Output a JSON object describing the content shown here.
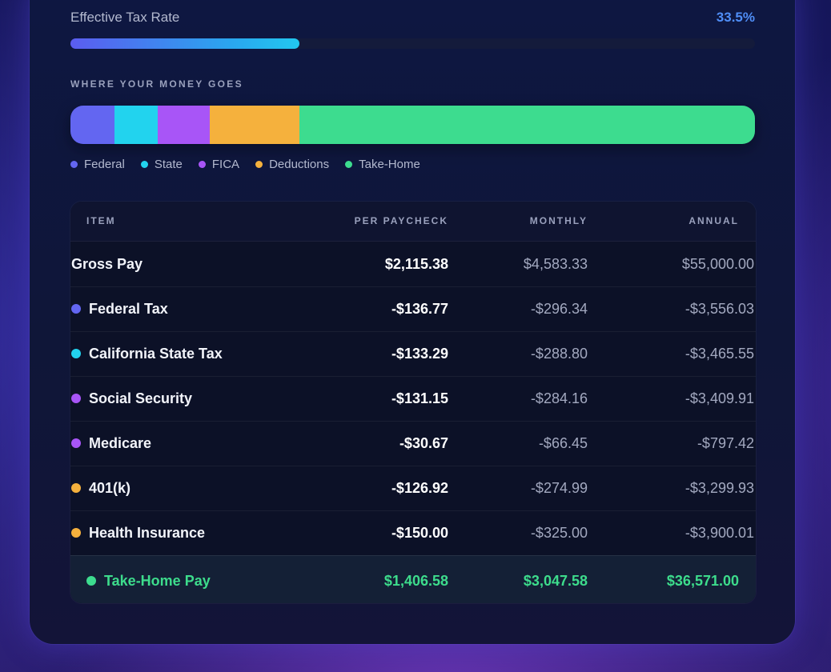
{
  "effective_tax": {
    "label": "Effective Tax Rate",
    "value": "33.5%",
    "progress": 0.335
  },
  "distribution": {
    "title": "WHERE YOUR MONEY GOES",
    "segments": [
      {
        "name": "Federal",
        "fraction": 0.0646,
        "color": "#6366f1"
      },
      {
        "name": "State",
        "fraction": 0.063,
        "color": "#22d3ee"
      },
      {
        "name": "FICA",
        "fraction": 0.0765,
        "color": "#a855f7"
      },
      {
        "name": "Deductions",
        "fraction": 0.1309,
        "color": "#f5b13d"
      },
      {
        "name": "Take-Home",
        "fraction": 0.665,
        "color": "#3ddc8f"
      }
    ]
  },
  "table": {
    "headers": {
      "item": "ITEM",
      "per_paycheck": "PER PAYCHECK",
      "monthly": "MONTHLY",
      "annual": "ANNUAL"
    },
    "rows": [
      {
        "item": "Gross Pay",
        "per_paycheck": "$2,115.38",
        "monthly": "$4,583.33",
        "annual": "$55,000.00",
        "dot": ""
      },
      {
        "item": "Federal Tax",
        "per_paycheck": "-$136.77",
        "monthly": "-$296.34",
        "annual": "-$3,556.03",
        "dot": "#6366f1"
      },
      {
        "item": "California State Tax",
        "per_paycheck": "-$133.29",
        "monthly": "-$288.80",
        "annual": "-$3,465.55",
        "dot": "#22d3ee"
      },
      {
        "item": "Social Security",
        "per_paycheck": "-$131.15",
        "monthly": "-$284.16",
        "annual": "-$3,409.91",
        "dot": "#a855f7"
      },
      {
        "item": "Medicare",
        "per_paycheck": "-$30.67",
        "monthly": "-$66.45",
        "annual": "-$797.42",
        "dot": "#a855f7"
      },
      {
        "item": "401(k)",
        "per_paycheck": "-$126.92",
        "monthly": "-$274.99",
        "annual": "-$3,299.93",
        "dot": "#f5b13d"
      },
      {
        "item": "Health Insurance",
        "per_paycheck": "-$150.00",
        "monthly": "-$325.00",
        "annual": "-$3,900.01",
        "dot": "#f5b13d"
      }
    ],
    "footer": {
      "item": "Take-Home Pay",
      "per_paycheck": "$1,406.58",
      "monthly": "$3,047.58",
      "annual": "$36,571.00",
      "dot": "#3ddc8f"
    }
  }
}
